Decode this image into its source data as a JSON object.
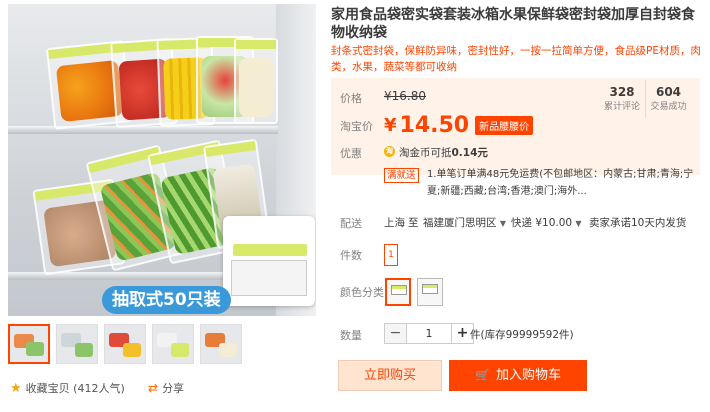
{
  "product": {
    "title": "家用食品袋密实袋套装冰箱水果保鲜袋密封袋加厚自封袋食物收纳袋",
    "subtitle": "封条式密封袋，保鲜防异味，密封性好，一按一拉简单方便，食品级PE材质，肉类，水果，蔬菜等都可收纳",
    "image_banner": "抽取式50只装"
  },
  "price": {
    "orig_label": "价格",
    "orig_value": "¥16.80",
    "tb_label": "淘宝价",
    "yen": "¥",
    "tb_value": "14.50",
    "tb_tag": "新品腰腰价",
    "stats": [
      {
        "num": "328",
        "text": "累计评论"
      },
      {
        "num": "604",
        "text": "交易成功"
      }
    ]
  },
  "promo": {
    "label": "优惠",
    "coin_icon": "淘",
    "coin_text": "淘金币可抵",
    "coin_amount": "0.14元",
    "mj_tag": "满就送",
    "mj_text": "1.单笔订单满48元免运费(不包邮地区：内蒙古;甘肃;青海;宁夏;新疆;西藏;台湾;香港;澳门;海外..."
  },
  "shipping": {
    "label": "配送",
    "from": "上海",
    "to_label": "至",
    "to": "福建厦门思明区",
    "method": "快递 ¥10.00",
    "promise": "卖家承诺10天内发货"
  },
  "options": {
    "count_label": "件数",
    "count_value": "1",
    "color_label": "颜色分类"
  },
  "quantity": {
    "label": "数量",
    "minus": "−",
    "value": "1",
    "plus": "+",
    "stock": "件(库存99999592件)"
  },
  "actions": {
    "buy_now": "立即购买",
    "add_cart": "加入购物车"
  },
  "gallery": {
    "fav_label": "收藏宝贝 (412人气)",
    "share_label": "分享"
  },
  "colors": {
    "accent": "#ff4400",
    "price_bg": "#fff2e8"
  }
}
